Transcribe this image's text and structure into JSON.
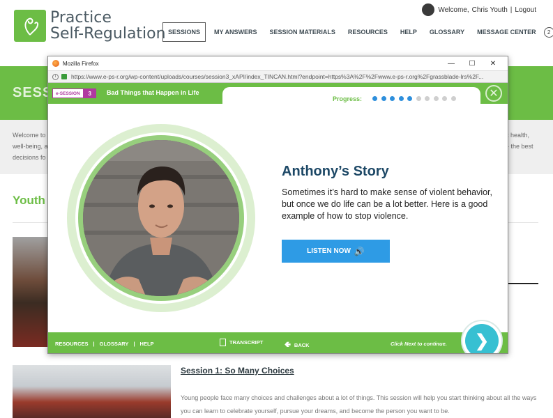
{
  "site": {
    "logo_line1": "Practice",
    "logo_line2": "Self-Regulation",
    "welcome": "Welcome,",
    "user_name": "Chris Youth",
    "separator": "|",
    "logout": "Logout",
    "nav": [
      "SESSIONS",
      "MY ANSWERS",
      "SESSION MATERIALS",
      "RESOURCES",
      "HELP",
      "GLOSSARY",
      "MESSAGE CENTER"
    ],
    "message_count": "2",
    "band_title": "SESS",
    "intro_left": [
      "Welcome to",
      "well-being, a",
      "decisions fo"
    ],
    "intro_right": [
      "t health,",
      "- the best"
    ],
    "youth_heading": "Youth",
    "session_title": "Session 1: So Many Choices",
    "session_desc": "Young people face many choices and challenges about a lot of things. This session will help you start thinking about all the ways you can learn to celebrate yourself, pursue your dreams, and become the person you want to be."
  },
  "popup": {
    "window_title": "Mozilla Firefox",
    "url": "https://www.e-ps-r.org/wp-content/uploads/courses/session3_xAPI/index_TINCAN.html?endpoint=https%3A%2F%2Fwww.e-ps-r.org%2Fgrassblade-lrs%2F...",
    "esession_label": "e-SESSION",
    "session_number": "3",
    "course_title": "Bad Things that Happen in Life",
    "progress_label": "Progress:",
    "progress_completed": 5,
    "progress_total": 10,
    "story_title": "Anthony’s Story",
    "story_text": "Sometimes it’s hard to make sense of violent behavior, but once we do life can be a lot better. Here is a good example of how to stop violence.",
    "listen_label": "LISTEN NOW",
    "footer": {
      "resources": "RESOURCES",
      "glossary": "GLOSSARY",
      "help": "HELP",
      "sep": "|",
      "transcript": "TRANSCRIPT",
      "back": "BACK",
      "click_next": "Click Next to continue."
    }
  },
  "colors": {
    "brand_green": "#6cbd45",
    "navy": "#1d4866",
    "listen_blue": "#2e9be5",
    "progress_done": "#2e8fdc",
    "progress_todo": "#cfcfcf",
    "next_teal": "#37c0d2",
    "esession_purple": "#b03aa0"
  },
  "icons": [
    "firefox-icon",
    "minimize-icon",
    "maximize-icon",
    "close-window-icon",
    "info-icon",
    "lock-icon",
    "close-circle-icon",
    "speaker-icon",
    "transcript-icon",
    "back-arrow-icon",
    "next-arrow-icon"
  ]
}
